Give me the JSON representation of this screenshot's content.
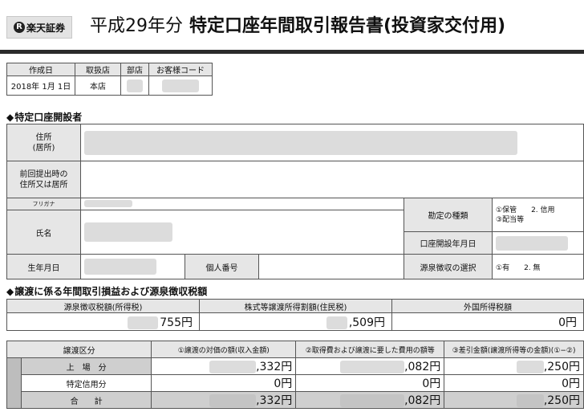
{
  "header": {
    "logo": "楽天証券",
    "title_year": "平成29年分",
    "title_main": "特定口座年間取引報告書(投資家交付用)"
  },
  "info": {
    "headers": [
      "作成日",
      "取扱店",
      "部店",
      "お客様コード"
    ],
    "created_date": "2018年 1月 1日",
    "branch": "本店"
  },
  "sections": {
    "account_holder": "特定口座開設者",
    "transfer": "譲渡に係る年間取引損益および源泉徴収税額"
  },
  "account": {
    "address_label": "住所\n(居所)",
    "prev_address_label": "前回提出時の\n住所又は居所",
    "furigana_label": "フリガナ",
    "name_label": "氏名",
    "birth_label": "生年月日",
    "mynumber_label": "個人番号",
    "account_type_label": "勘定の種類",
    "account_type_options_1": "①保管　　2. 信用",
    "account_type_options_2": "③配当等",
    "open_date_label": "口座開設年月日",
    "withholding_label": "源泉徴収の選択",
    "withholding_options": "①有　　2. 無"
  },
  "tax": {
    "headers": [
      "源泉徴収税額(所得税)",
      "株式等譲渡所得割額(住民税)",
      "外国所得税額"
    ],
    "values": [
      "755円",
      ",509円",
      "0円"
    ]
  },
  "trades": {
    "headers": [
      "譲渡区分",
      "①譲渡の対価の額(収入金額)",
      "②取得費および譲渡に要した費用の額等",
      "③差引金額(譲渡所得等の金額)(①−②)"
    ],
    "rows": [
      {
        "label": "上　場　分",
        "c1": ",332円",
        "c2": ",082円",
        "c3": ",250円"
      },
      {
        "label": "特定信用分",
        "c1": "0円",
        "c2": "0円",
        "c3": "0円"
      },
      {
        "label": "合　　計",
        "c1": ",332円",
        "c2": ",082円",
        "c3": ",250円"
      }
    ]
  }
}
